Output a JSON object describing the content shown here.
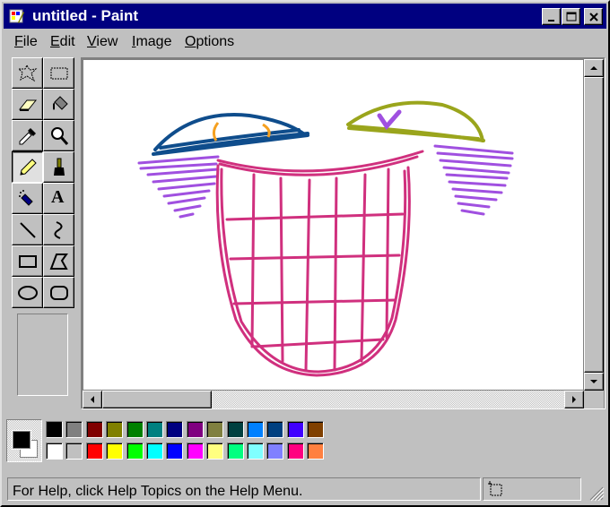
{
  "window": {
    "title": "untitled - Paint"
  },
  "menu": [
    "File",
    "Edit",
    "View",
    "Image",
    "Options"
  ],
  "status": {
    "help_text": "For Help, click Help Topics on the Help Menu."
  },
  "colors": {
    "foreground": "#000000",
    "background": "#ffffff",
    "palette_top": [
      "#000000",
      "#808080",
      "#800000",
      "#808000",
      "#008000",
      "#008080",
      "#000080",
      "#800080",
      "#808040",
      "#004040",
      "#0080ff",
      "#004080",
      "#4000ff",
      "#804000"
    ],
    "palette_bottom": [
      "#ffffff",
      "#c0c0c0",
      "#ff0000",
      "#ffff00",
      "#00ff00",
      "#00ffff",
      "#0000ff",
      "#ff00ff",
      "#ffff80",
      "#00ff80",
      "#80ffff",
      "#8080ff",
      "#ff0080",
      "#ff8040"
    ]
  },
  "tools": [
    {
      "name": "free-form-select-icon",
      "active": false
    },
    {
      "name": "select-icon",
      "active": false
    },
    {
      "name": "eraser-icon",
      "active": false
    },
    {
      "name": "fill-with-color-icon",
      "active": false
    },
    {
      "name": "pick-color-icon",
      "active": false
    },
    {
      "name": "magnifier-icon",
      "active": false
    },
    {
      "name": "pencil-icon",
      "active": true
    },
    {
      "name": "brush-icon",
      "active": false
    },
    {
      "name": "airbrush-icon",
      "active": false
    },
    {
      "name": "text-icon",
      "active": false
    },
    {
      "name": "line-icon",
      "active": false
    },
    {
      "name": "curve-icon",
      "active": false
    },
    {
      "name": "rectangle-icon",
      "active": false
    },
    {
      "name": "polygon-icon",
      "active": false
    },
    {
      "name": "ellipse-icon",
      "active": false
    },
    {
      "name": "rounded-rectangle-icon",
      "active": false
    }
  ],
  "text_tool_glyph": "A"
}
